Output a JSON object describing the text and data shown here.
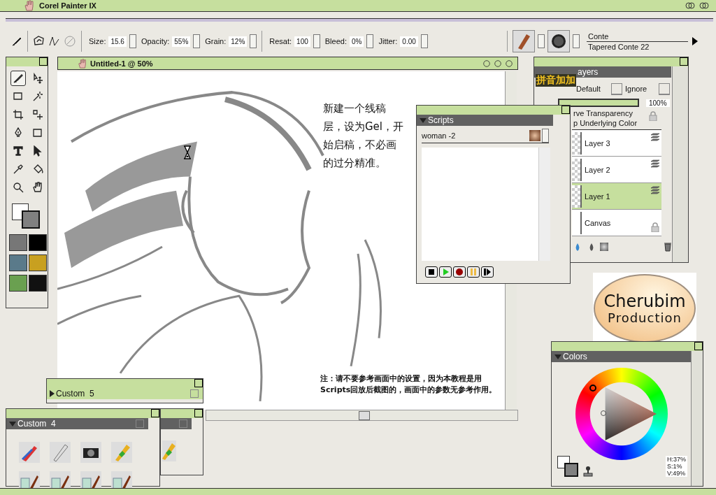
{
  "app_title": "Corel Painter IX",
  "property_bar": {
    "fields": [
      {
        "label": "Size:",
        "value": "15.6"
      },
      {
        "label": "Opacity:",
        "value": "55%"
      },
      {
        "label": "Grain:",
        "value": "12%"
      },
      {
        "label": "Resat:",
        "value": "100"
      },
      {
        "label": "Bleed:",
        "value": "0%"
      },
      {
        "label": "Jitter:",
        "value": "0.00"
      }
    ],
    "brush_category": "Conte",
    "brush_variant": "Tapered Conte 22"
  },
  "toolbox": {
    "tools": [
      {
        "kind": "brush",
        "selected": true
      },
      {
        "kind": "move",
        "selected": false
      },
      {
        "kind": "marquee",
        "selected": false
      },
      {
        "kind": "wand",
        "selected": false
      },
      {
        "kind": "crop",
        "selected": false
      },
      {
        "kind": "selmove",
        "selected": false
      },
      {
        "kind": "pen",
        "selected": false
      },
      {
        "kind": "rect",
        "selected": false
      },
      {
        "kind": "text",
        "selected": false
      },
      {
        "kind": "pointer",
        "selected": false
      },
      {
        "kind": "dropper",
        "selected": false
      },
      {
        "kind": "bucket",
        "selected": false
      },
      {
        "kind": "zoom",
        "selected": false
      },
      {
        "kind": "hand",
        "selected": false
      }
    ]
  },
  "document": {
    "title": "Untitled-1 @ 50%",
    "note": "新建一个线稿层，设为Gel，开始启稿，不必画的过分精准。",
    "footnote": "注：请不要参考画面中的设置，因为本教程是用Scripts回放后截图的，画面中的参数无参考作用。"
  },
  "ime_status": "拼音加加",
  "layers": {
    "title": "ayers",
    "composite_method": "Default",
    "composite_depth": "Ignore",
    "opacity": "100%",
    "options": [
      "rve Transparency",
      "p Underlying Color"
    ],
    "items": [
      {
        "name": "Layer 3",
        "kind": "layer",
        "selected": false
      },
      {
        "name": "Layer 2",
        "kind": "layer",
        "selected": false
      },
      {
        "name": "Layer 1",
        "kind": "layer",
        "selected": true
      },
      {
        "name": "Canvas",
        "kind": "canvas",
        "selected": false
      }
    ]
  },
  "scripts": {
    "title": "Scripts",
    "script": "woman -2"
  },
  "logo": {
    "line1": "Cherubim",
    "line2": "Production"
  },
  "colors": {
    "title": "Colors",
    "readout": [
      "H:37%",
      "S:1%",
      "V:49%"
    ]
  },
  "palettes": [
    {
      "title": "Custom  5",
      "expanded": false
    },
    {
      "title": "Custom  4",
      "expanded": true
    }
  ]
}
